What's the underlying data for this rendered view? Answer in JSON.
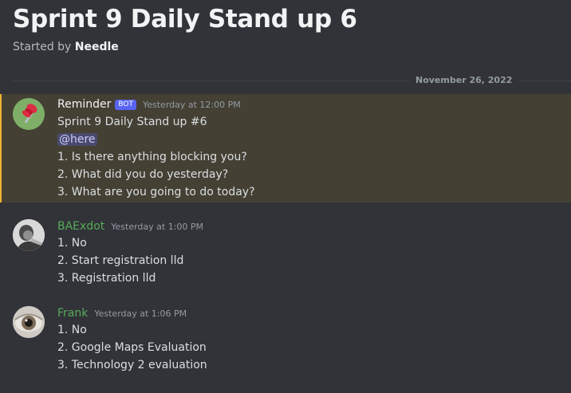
{
  "thread": {
    "title": "Sprint 9 Daily Stand up 6",
    "started_by_prefix": "Started by",
    "starter_name": "Needle"
  },
  "date_divider": "November 26, 2022",
  "messages": [
    {
      "author": "Reminder",
      "author_color": "#f2f3f5",
      "bot_tag": "BOT",
      "timestamp": "Yesterday at 12:00 PM",
      "lines": [
        "Sprint 9 Daily Stand up #6",
        "@here",
        "1. Is there anything blocking you?",
        "2. What did you do yesterday?",
        "3. What are you going to do today?"
      ],
      "avatar": "pushpin-icon"
    },
    {
      "author": "BAExdot",
      "author_color": "#57ab5a",
      "timestamp": "Yesterday at 1:00 PM",
      "lines": [
        "1. No",
        "2. Start registration lld",
        "3. Registration lld"
      ],
      "avatar": "user-photo"
    },
    {
      "author": "Frank",
      "author_color": "#57ab5a",
      "timestamp": "Yesterday at 1:06 PM",
      "lines": [
        "1. No",
        "2. Google Maps Evaluation",
        "3. Technology 2 evaluation"
      ],
      "avatar": "eye-photo"
    }
  ],
  "colors": {
    "background": "#313338",
    "highlight": "#444034",
    "highlight_bar": "#f0b232",
    "bot_tag": "#5865f2",
    "member_name": "#57ab5a"
  }
}
